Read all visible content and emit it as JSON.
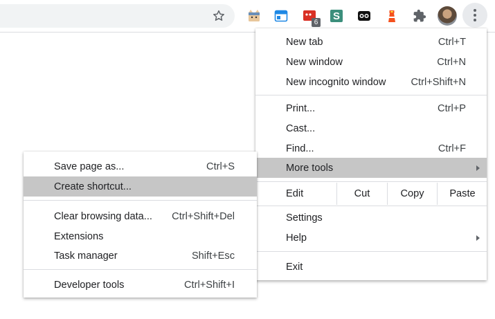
{
  "toolbar": {
    "extensions": [
      {
        "icon": "cat-face-icon",
        "badge": ""
      },
      {
        "icon": "window-blue-icon",
        "badge": ""
      },
      {
        "icon": "red-app-icon",
        "badge": "6"
      },
      {
        "icon": "s-green-icon",
        "badge": ""
      },
      {
        "icon": "binoculars-icon",
        "badge": ""
      },
      {
        "icon": "lighthouse-icon",
        "badge": ""
      },
      {
        "icon": "puzzle-icon",
        "badge": ""
      }
    ]
  },
  "main_menu": {
    "new_tab": {
      "label": "New tab",
      "shortcut": "Ctrl+T"
    },
    "new_window": {
      "label": "New window",
      "shortcut": "Ctrl+N"
    },
    "new_incognito": {
      "label": "New incognito window",
      "shortcut": "Ctrl+Shift+N"
    },
    "print": {
      "label": "Print...",
      "shortcut": "Ctrl+P"
    },
    "cast": {
      "label": "Cast...",
      "shortcut": ""
    },
    "find": {
      "label": "Find...",
      "shortcut": "Ctrl+F"
    },
    "more_tools": {
      "label": "More tools"
    },
    "edit": {
      "label": "Edit",
      "cut": "Cut",
      "copy": "Copy",
      "paste": "Paste"
    },
    "settings": {
      "label": "Settings"
    },
    "help": {
      "label": "Help"
    },
    "exit": {
      "label": "Exit"
    }
  },
  "sub_menu": {
    "save_page": {
      "label": "Save page as...",
      "shortcut": "Ctrl+S"
    },
    "create_shortcut": {
      "label": "Create shortcut...",
      "shortcut": ""
    },
    "clear_data": {
      "label": "Clear browsing data...",
      "shortcut": "Ctrl+Shift+Del"
    },
    "extensions": {
      "label": "Extensions",
      "shortcut": ""
    },
    "task_manager": {
      "label": "Task manager",
      "shortcut": "Shift+Esc"
    },
    "dev_tools": {
      "label": "Developer tools",
      "shortcut": "Ctrl+Shift+I"
    }
  },
  "colors": {
    "highlight": "#c6c6c6",
    "omnibox": "#f1f3f4",
    "separator": "#dadce0"
  }
}
